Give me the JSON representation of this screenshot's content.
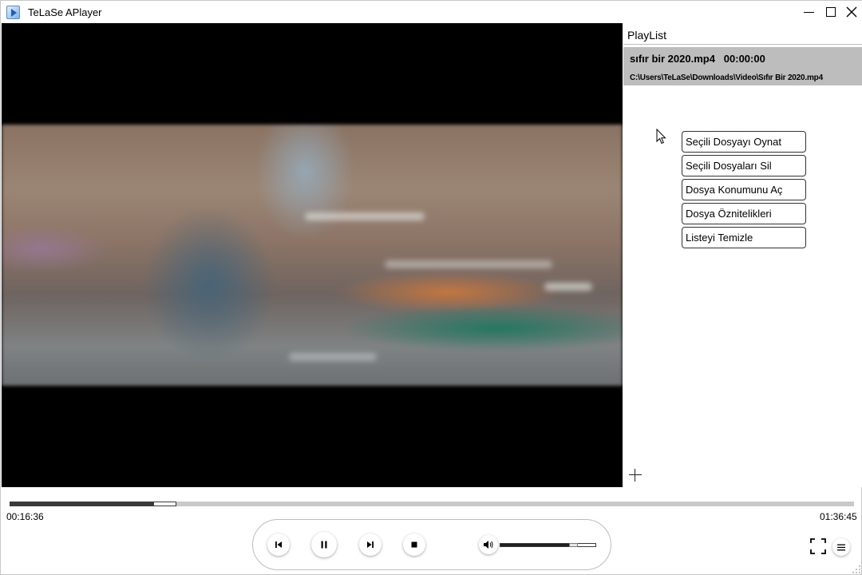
{
  "window": {
    "title": "TeLaSe APlayer",
    "icons": [
      "app-icon",
      "minimize-icon",
      "maximize-icon",
      "close-icon"
    ]
  },
  "playlist": {
    "title": "PlayList",
    "item": {
      "name_line": "sıfır bir 2020.mp4   00:00:00",
      "path": "C:\\Users\\TeLaSe\\Downloads\\Video\\Sıfır Bir 2020.mp4"
    },
    "context_menu": [
      "Seçili Dosyayı Oynat",
      "Seçili Dosyaları Sil",
      "Dosya Konumunu Aç",
      "Dosya Öznitelikleri",
      "Listeyi Temizle"
    ]
  },
  "player": {
    "current_time": "00:16:36",
    "total_time": "01:36:45",
    "progress_fraction": 0.1715,
    "volume_fraction": 0.75
  },
  "colors": {
    "video_background": "#000000",
    "selected_item": "#bdbdbd",
    "seek_played": "#3a3a3a",
    "seek_track": "#c9c9c9"
  }
}
